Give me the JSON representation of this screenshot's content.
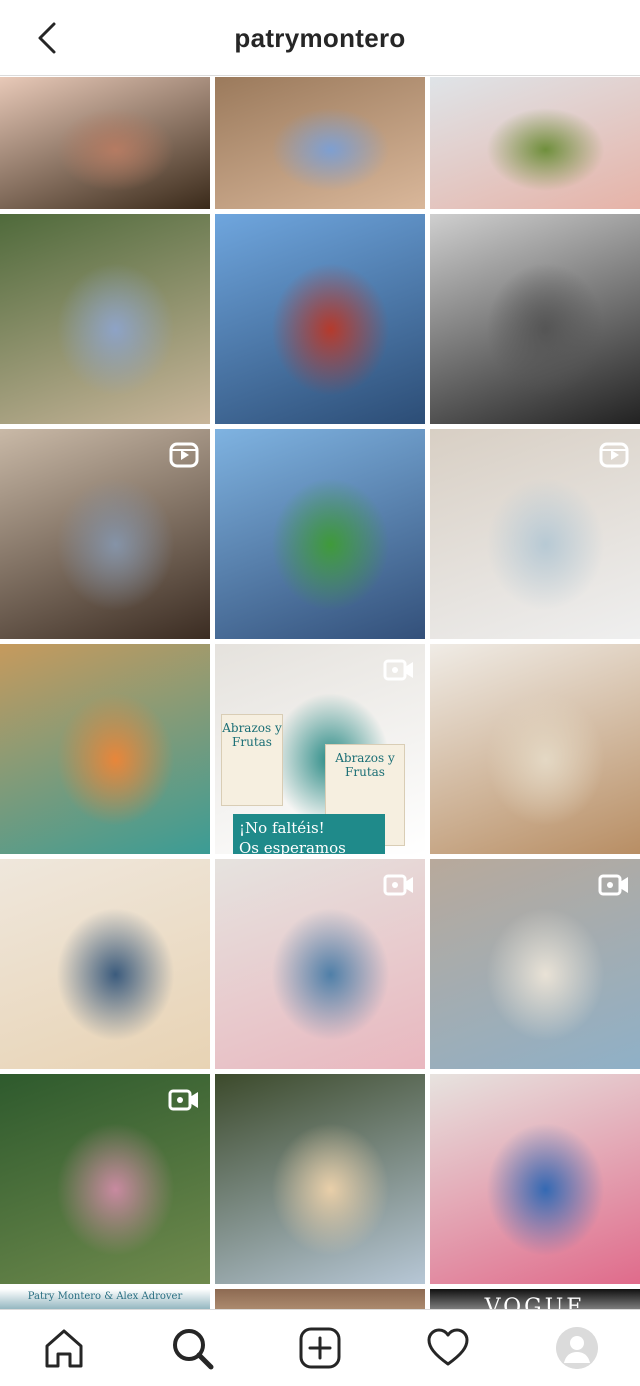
{
  "header": {
    "title": "patrymontero",
    "back_icon": "chevron-left-icon"
  },
  "grid": {
    "posts": [
      {
        "id": "post-1",
        "overlay": null,
        "colors": [
          "#e8c9b8",
          "#b57b62",
          "#3a2a1a"
        ]
      },
      {
        "id": "post-2",
        "overlay": null,
        "colors": [
          "#9b7a5c",
          "#7e9fd1",
          "#d9b79a"
        ]
      },
      {
        "id": "post-3",
        "overlay": null,
        "colors": [
          "#dfe4e8",
          "#6f8f3c",
          "#e6b3a8"
        ]
      },
      {
        "id": "post-4",
        "overlay": null,
        "colors": [
          "#4f6a3b",
          "#8ea3c6",
          "#c8b59a"
        ]
      },
      {
        "id": "post-5",
        "overlay": null,
        "colors": [
          "#6fa6de",
          "#b53a2c",
          "#2c4d76"
        ]
      },
      {
        "id": "post-6",
        "overlay": null,
        "colors": [
          "#cfcfcf",
          "#555555",
          "#222222"
        ]
      },
      {
        "id": "post-7",
        "overlay": "clip-icon",
        "colors": [
          "#c9b9a7",
          "#8593a7",
          "#3b2c22"
        ]
      },
      {
        "id": "post-8",
        "overlay": null,
        "colors": [
          "#7fb3e1",
          "#3f9a3a",
          "#33507a"
        ]
      },
      {
        "id": "post-9",
        "overlay": "clip-icon",
        "colors": [
          "#d8cfc4",
          "#b7c9d4",
          "#efefef"
        ]
      },
      {
        "id": "post-10",
        "overlay": null,
        "colors": [
          "#c69a5d",
          "#e8863a",
          "#3b9c95"
        ]
      },
      {
        "id": "post-11",
        "overlay": "video-icon",
        "colors": [
          "#e5e2dd",
          "#2a8b86",
          "#ffffff"
        ]
      },
      {
        "id": "post-12",
        "overlay": null,
        "colors": [
          "#f0ece6",
          "#e4d8c4",
          "#b88e64"
        ]
      },
      {
        "id": "post-13",
        "overlay": null,
        "colors": [
          "#efe7dc",
          "#3b5b7d",
          "#e8d3b4"
        ]
      },
      {
        "id": "post-14",
        "overlay": "video-icon",
        "colors": [
          "#e6e3df",
          "#4f7fa8",
          "#e9b7bf"
        ]
      },
      {
        "id": "post-15",
        "overlay": "video-icon",
        "colors": [
          "#b8a99b",
          "#e9e2d6",
          "#8fb0c7"
        ]
      },
      {
        "id": "post-16",
        "overlay": "video-icon",
        "colors": [
          "#2e5a2d",
          "#c88aa0",
          "#6f8a4d"
        ]
      },
      {
        "id": "post-17",
        "overlay": null,
        "colors": [
          "#3c4a2b",
          "#e9cfa9",
          "#b7c7d6"
        ]
      },
      {
        "id": "post-18",
        "overlay": null,
        "colors": [
          "#e7e3df",
          "#3469b3",
          "#e06b8b"
        ]
      }
    ],
    "post_11_caption": [
      "¡No faltéis!",
      "Os esperamos"
    ],
    "post_11_books": [
      "Abrazos y Frutas",
      "Abrazos y Frutas"
    ],
    "partial_row": [
      {
        "id": "post-19",
        "text": "Patry Montero & Alex Adrover",
        "colors": [
          "#ffffff",
          "#2a6f82"
        ]
      },
      {
        "id": "post-20",
        "text": "",
        "colors": [
          "#8d6a52",
          "#c9a98a"
        ]
      },
      {
        "id": "post-21",
        "text": "VOGUE",
        "colors": [
          "#111111",
          "#e8e8e8"
        ]
      }
    ]
  },
  "tabbar": {
    "tabs": [
      {
        "name": "tab-home",
        "icon": "home-icon"
      },
      {
        "name": "tab-search",
        "icon": "search-icon",
        "active": true
      },
      {
        "name": "tab-new-post",
        "icon": "plus-square-icon"
      },
      {
        "name": "tab-activity",
        "icon": "heart-icon"
      },
      {
        "name": "tab-profile",
        "icon": "avatar-icon"
      }
    ]
  }
}
